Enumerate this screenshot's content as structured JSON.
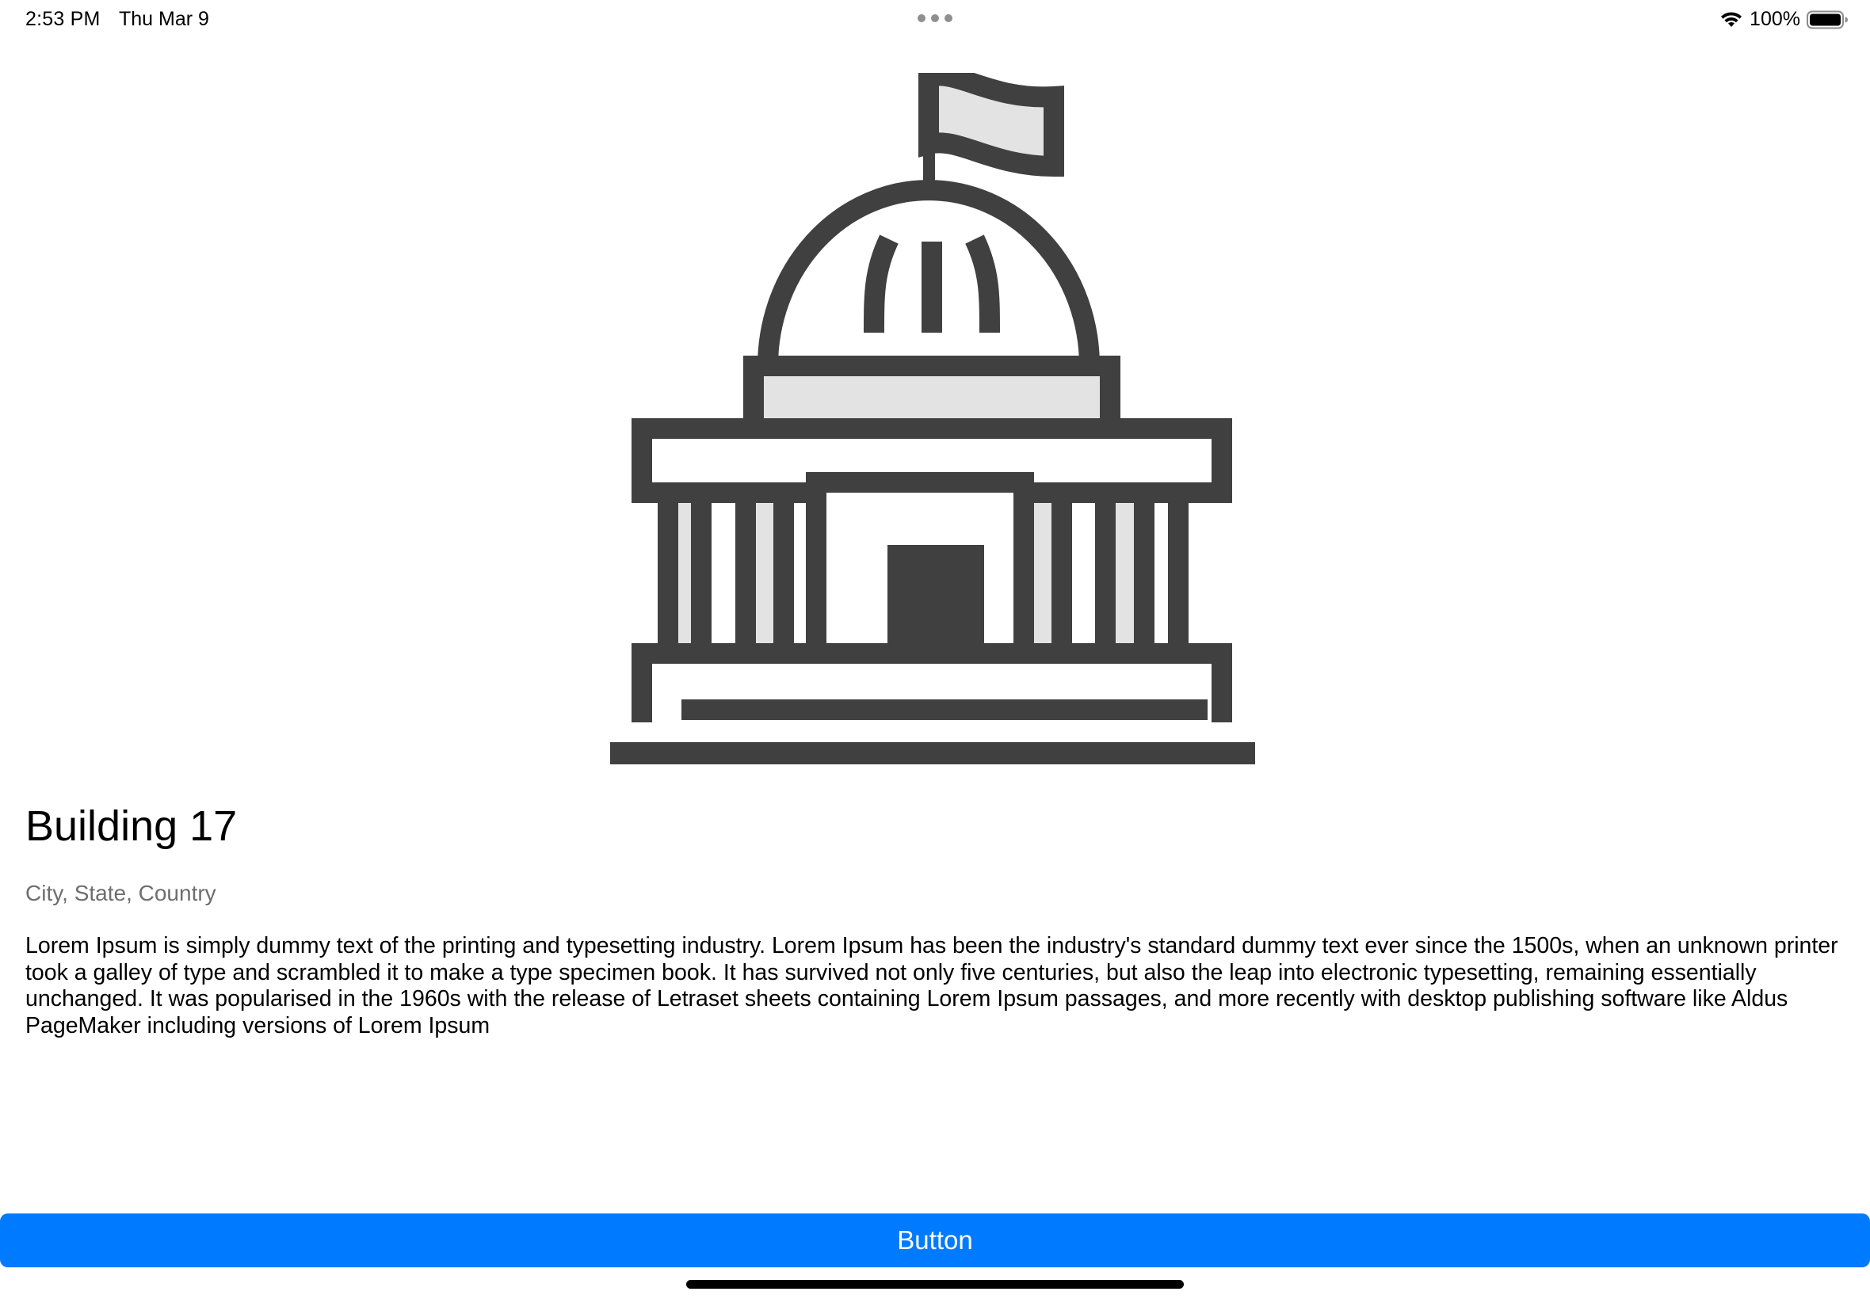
{
  "status_bar": {
    "time": "2:53 PM",
    "date": "Thu Mar 9",
    "battery": "100%"
  },
  "icons": {
    "wifi": "wifi-icon",
    "battery": "battery-icon",
    "hero": "capitol-building-icon"
  },
  "detail": {
    "title": "Building 17",
    "subtitle": "City, State, Country",
    "description": "Lorem Ipsum is simply dummy text of the printing and typesetting industry. Lorem Ipsum has been the industry's standard dummy text ever since the 1500s, when an unknown printer took a galley of type and scrambled it to make a type specimen book. It has survived not only five centuries, but also the leap into electronic typesetting, remaining essentially unchanged. It was popularised in the 1960s with the release of Letraset sheets containing Lorem Ipsum passages, and more recently with desktop publishing software like Aldus PageMaker including versions of Lorem Ipsum"
  },
  "action": {
    "button_label": "Button"
  },
  "colors": {
    "accent": "#007aff",
    "icon_stroke": "#404040",
    "icon_fill": "#e3e3e3",
    "subtitle": "#6d6d72"
  }
}
